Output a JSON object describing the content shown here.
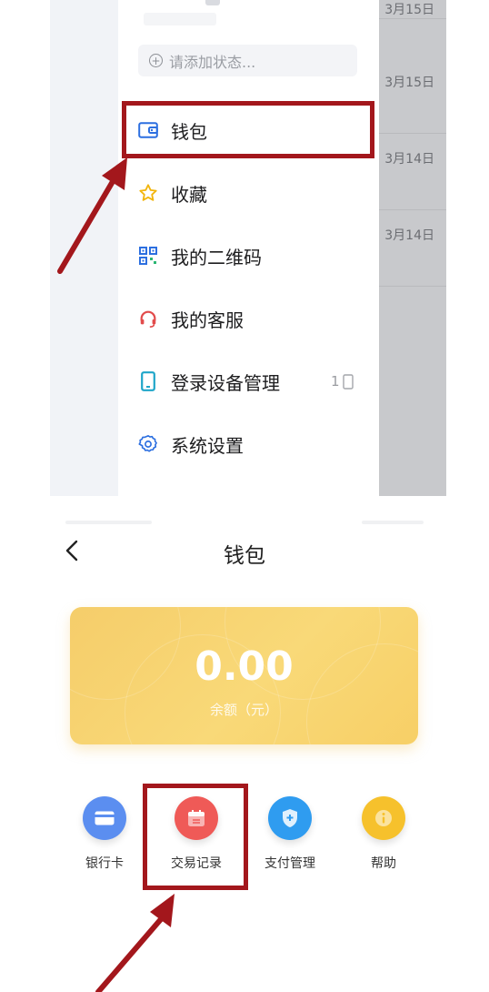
{
  "drawer": {
    "status_placeholder": "请添加状态...",
    "menu": [
      {
        "label": "钱包",
        "icon": "wallet-icon"
      },
      {
        "label": "收藏",
        "icon": "star-icon"
      },
      {
        "label": "我的二维码",
        "icon": "qr-code-icon"
      },
      {
        "label": "我的客服",
        "icon": "headset-icon"
      },
      {
        "label": "登录设备管理",
        "icon": "phone-icon",
        "extra": "1"
      },
      {
        "label": "系统设置",
        "icon": "gear-icon"
      }
    ],
    "behind_dates": [
      "3月15日",
      "3月15日",
      "3月14日",
      "3月14日"
    ]
  },
  "wallet": {
    "title": "钱包",
    "balance": "0.00",
    "balance_label": "余额（元）",
    "actions": [
      {
        "label": "银行卡",
        "icon": "bank-card-icon",
        "color": "#5b8ef0"
      },
      {
        "label": "交易记录",
        "icon": "calendar-icon",
        "color": "#ef5a57"
      },
      {
        "label": "支付管理",
        "icon": "shield-icon",
        "color": "#2f9cf0"
      },
      {
        "label": "帮助",
        "icon": "info-icon",
        "color": "#f6c12c"
      }
    ]
  },
  "colors": {
    "highlight": "#a3171c",
    "card": "#f8d46f"
  }
}
